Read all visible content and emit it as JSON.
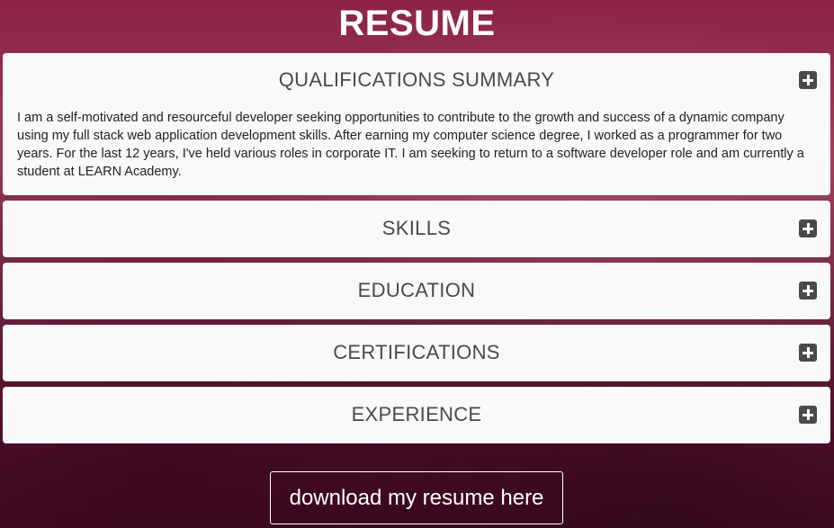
{
  "page": {
    "title": "RESUME"
  },
  "sections": {
    "qualifications": {
      "title": "QUALIFICATIONS SUMMARY",
      "body": "I am a self-motivated and resourceful developer seeking opportunities to contribute to the growth and success of a dynamic company using my full stack web application development skills. After earning my computer science degree, I worked as a programmer for two years. For the last 12 years, I've held various roles in corporate IT. I am seeking to return to a software developer role and am currently a student at LEARN Academy.",
      "icon": "plus-square-icon"
    },
    "skills": {
      "title": "SKILLS",
      "icon": "plus-square-icon"
    },
    "education": {
      "title": "EDUCATION",
      "icon": "plus-square-icon"
    },
    "certifications": {
      "title": "CERTIFICATIONS",
      "icon": "plus-square-icon"
    },
    "experience": {
      "title": "EXPERIENCE",
      "icon": "plus-square-icon"
    }
  },
  "download": {
    "label": "download my resume here"
  },
  "colors": {
    "background_top": "#8c2446",
    "background_bottom": "#4a0f26",
    "panel": "#f9f9f9",
    "panel_text": "#4a4a4a",
    "icon": "#4a4a4a"
  }
}
